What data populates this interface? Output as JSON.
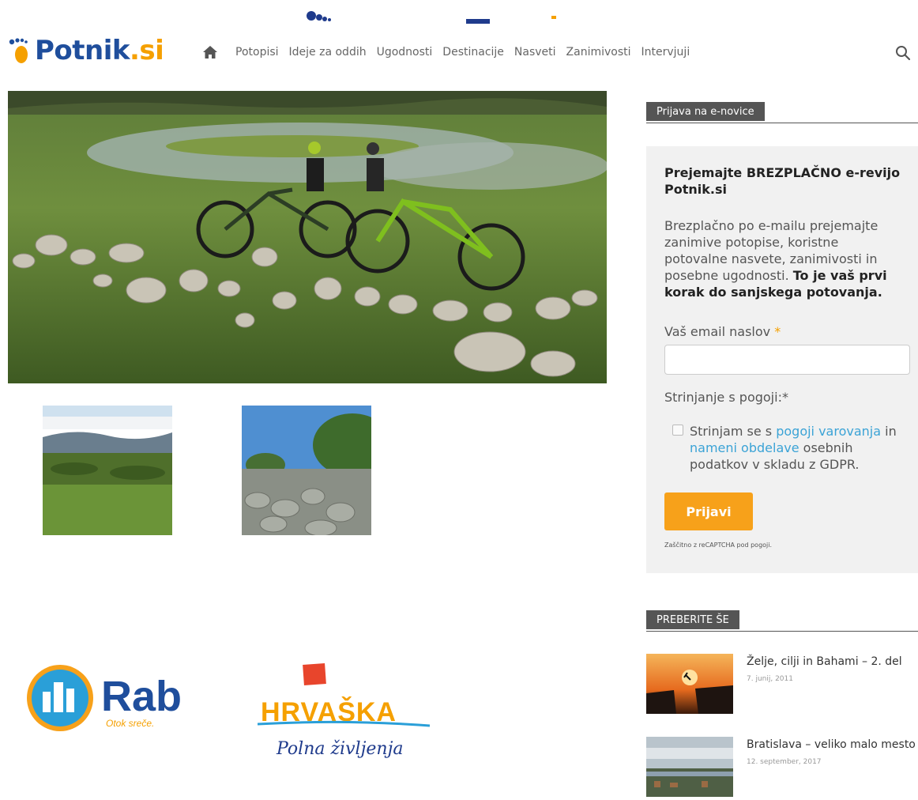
{
  "header": {
    "logo_part1": "Potnik",
    "logo_part2": ".si",
    "nav_items": [
      "Potopisi",
      "Ideje za oddih",
      "Ugodnosti",
      "Destinacije",
      "Nasveti",
      "Zanimivosti",
      "Intervjuji"
    ]
  },
  "sponsors": {
    "rab_name": "Rab",
    "rab_tagline": "Otok sreče.",
    "croatia_name": "HRVAŠKA",
    "croatia_tagline": "Polna življenja"
  },
  "newsletter": {
    "heading": "Prijava na e-novice",
    "title": "Prejemajte BREZPLAČNO e-revijo Potnik.si",
    "text": "Brezplačno po e-mailu prejemajte zanimive potopise, koristne potovalne nasvete, zanimivosti in posebne ugodnosti.",
    "text_bold": "To je vaš prvi korak do sanjskega potovanja.",
    "email_label": "Vaš email naslov",
    "required_mark": "*",
    "consent_label": "Strinjanje s pogoji:*",
    "consent_pre": "Strinjam se s",
    "consent_link1": "pogoji varovanja",
    "consent_mid": "in",
    "consent_link2": "nameni obdelave",
    "consent_post": "osebnih podatkov v skladu z GDPR.",
    "button": "Prijavi",
    "recaptcha": "Zaščitno z reCAPTCHA pod pogoji."
  },
  "read_more": {
    "heading": "PREBERITE ŠE",
    "posts": [
      {
        "title": "Želje, cilji in Bahami – 2. del",
        "date": "7. junij, 2011"
      },
      {
        "title": "Bratislava – veliko malo mesto",
        "date": "12. september, 2017"
      }
    ]
  }
}
